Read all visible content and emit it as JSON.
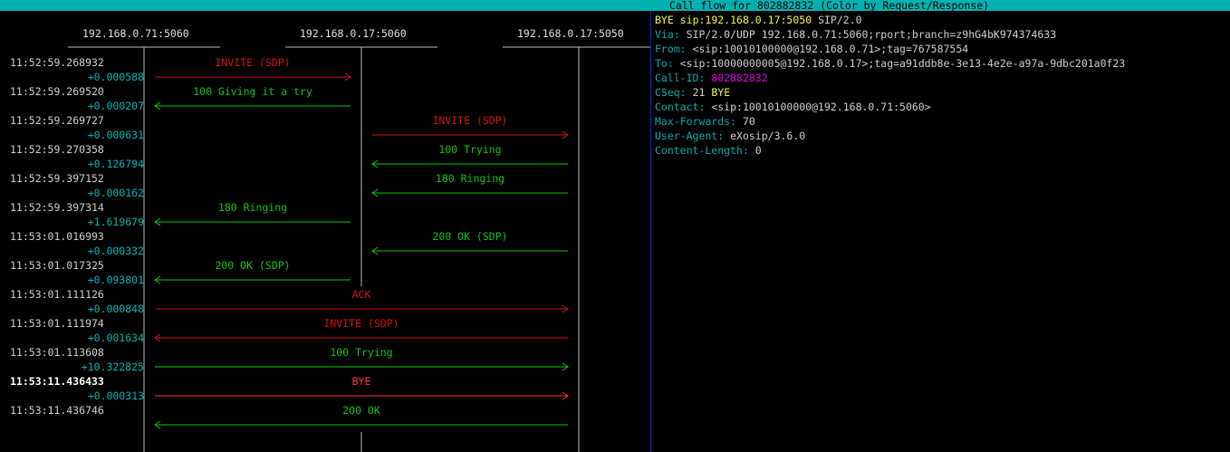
{
  "title": "Call flow for 802882832 (Color by Request/Response)",
  "colors": {
    "request": "#d01010",
    "response": "#10c010",
    "highlight_request": "#ff3030",
    "title_bg": "#00b0b0",
    "delta": "#00b0b0"
  },
  "hosts": [
    "192.168.0.71:5060",
    "192.168.0.17:5060",
    "192.168.0.17:5050"
  ],
  "messages": [
    {
      "time": "11:52:59.268932",
      "delta": "+0.000588",
      "label": "INVITE (SDP)",
      "from": 0,
      "to": 1,
      "kind": "request"
    },
    {
      "time": "11:52:59.269520",
      "delta": "+0.000207",
      "label": "100 Giving it a try",
      "from": 1,
      "to": 0,
      "kind": "response"
    },
    {
      "time": "11:52:59.269727",
      "delta": "+0.000631",
      "label": "INVITE (SDP)",
      "from": 1,
      "to": 2,
      "kind": "request"
    },
    {
      "time": "11:52:59.270358",
      "delta": "+0.126794",
      "label": "100 Trying",
      "from": 2,
      "to": 1,
      "kind": "response"
    },
    {
      "time": "11:52:59.397152",
      "delta": "+0.000162",
      "label": "180 Ringing",
      "from": 2,
      "to": 1,
      "kind": "response"
    },
    {
      "time": "11:52:59.397314",
      "delta": "+1.619679",
      "label": "180 Ringing",
      "from": 1,
      "to": 0,
      "kind": "response"
    },
    {
      "time": "11:53:01.016993",
      "delta": "+0.000332",
      "label": "200 OK (SDP)",
      "from": 2,
      "to": 1,
      "kind": "response"
    },
    {
      "time": "11:53:01.017325",
      "delta": "+0.093801",
      "label": "200 OK (SDP)",
      "from": 1,
      "to": 0,
      "kind": "response"
    },
    {
      "time": "11:53:01.111126",
      "delta": "+0.000848",
      "label": "ACK",
      "from": 0,
      "to": 2,
      "kind": "request"
    },
    {
      "time": "11:53:01.111974",
      "delta": "+0.001634",
      "label": "INVITE (SDP)",
      "from": 2,
      "to": 0,
      "kind": "request"
    },
    {
      "time": "11:53:01.113608",
      "delta": "+10.322825",
      "label": "100 Trying",
      "from": 0,
      "to": 2,
      "kind": "response"
    },
    {
      "time": "11:53:11.436433",
      "delta": "+0.000313",
      "label": "BYE",
      "from": 0,
      "to": 2,
      "kind": "request",
      "selected": true
    },
    {
      "time": "11:53:11.436746",
      "delta": "",
      "label": "200 OK",
      "from": 2,
      "to": 0,
      "kind": "response"
    }
  ],
  "raw": {
    "start_line": {
      "method": "BYE",
      "uri": "sip:192.168.0.17:5050",
      "version": "SIP/2.0"
    },
    "via": {
      "name": "Via:",
      "value": "SIP/2.0/UDP 192.168.0.71:5060;rport;branch=z9hG4bK974374633"
    },
    "from": {
      "name": "From:",
      "value": "<sip:10010100000@192.168.0.71>;tag=767587554"
    },
    "to": {
      "name": "To:",
      "value": "<sip:10000000005@192.168.0.17>;tag=a91ddb8e-3e13-4e2e-a97a-9dbc201a0f23"
    },
    "call_id": {
      "name": "Call-ID:",
      "value": "802882832"
    },
    "cseq": {
      "name": "CSeq:",
      "num": "21",
      "method": "BYE"
    },
    "contact": {
      "name": "Contact:",
      "value": "<sip:10010100000@192.168.0.71:5060>"
    },
    "max_forwards": {
      "name": "Max-Forwards:",
      "value": "70"
    },
    "user_agent": {
      "name": "User-Agent:",
      "value": "eXosip/3.6.0"
    },
    "content_length": {
      "name": "Content-Length:",
      "value": "0"
    }
  }
}
